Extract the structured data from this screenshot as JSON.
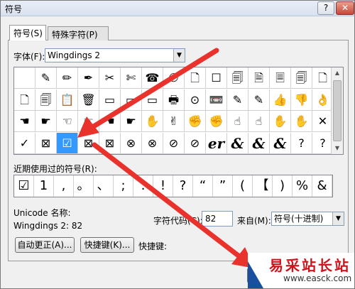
{
  "window": {
    "title": "符号",
    "help_label": "?",
    "close_label": "✕"
  },
  "tabs": [
    {
      "label": "符号(S)",
      "active": true
    },
    {
      "label": "特殊字符(P)",
      "active": false
    }
  ],
  "font": {
    "label": "字体(F):",
    "value": "Wingdings 2"
  },
  "symbols": {
    "rows": [
      [
        "",
        "✎",
        "✏",
        "✒",
        "✂",
        "✄",
        "☎",
        "✆",
        "🗋",
        "☐",
        "🗐",
        "🗎",
        "🗏",
        "🗐",
        "🗋"
      ],
      [
        "🗋",
        "🗐",
        "📋",
        "🗑",
        "▭",
        "▭",
        "▭",
        "🖶",
        "⊙",
        "📼",
        "✎",
        "✎",
        "👍",
        "👎",
        "👌"
      ],
      [
        "☚",
        "☛",
        "☜",
        "☞",
        "☚",
        "☛",
        "✋",
        "✌",
        "✊",
        "✊",
        "☝",
        "☝",
        "✋",
        "✋",
        "✕"
      ],
      [
        "✓",
        "⊠",
        "☑",
        "⊠",
        "⊠",
        "⊗",
        "⊗",
        "⊘",
        "⊘",
        "er",
        "&",
        "&",
        "&",
        "?",
        "?"
      ]
    ],
    "selected_index": {
      "row": 3,
      "col": 2
    }
  },
  "recent": {
    "label": "近期使用过的符号(R):",
    "items": [
      "☑",
      "1",
      ",",
      "。",
      "、",
      ";",
      ":",
      "!",
      "?",
      "“",
      "”",
      "(",
      "【",
      ")",
      "%",
      "&"
    ]
  },
  "unicode_name": {
    "label": "Unicode 名称:",
    "value": "Wingdings 2: 82"
  },
  "char_code": {
    "label": "字符代码(C):",
    "value": "82"
  },
  "from": {
    "label": "来自(M):",
    "value": "符号(十进制)"
  },
  "buttons": {
    "autocorrect": "自动更正(A)...",
    "shortcut_key": "快捷键(K)...",
    "shortcut_label": "快捷键:",
    "insert": "插"
  },
  "watermark": {
    "title": "易采站长站",
    "url": "www.easck.com"
  },
  "colors": {
    "selection": "#3399ff",
    "arrow": "#e8322b",
    "watermark_red": "#d0121b"
  }
}
